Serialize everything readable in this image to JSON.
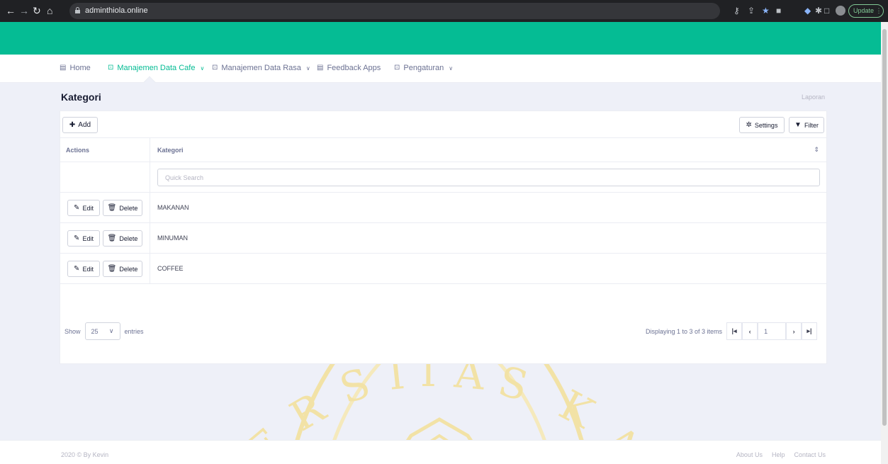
{
  "browser": {
    "url": "adminthiola.online",
    "update_label": "Update"
  },
  "menu": {
    "items": [
      {
        "label": "Home",
        "icon": "layout-icon"
      },
      {
        "label": "Manajemen Data Cafe",
        "icon": "box-icon",
        "active": true
      },
      {
        "label": "Manajemen Data Rasa",
        "icon": "box-icon"
      },
      {
        "label": "Feedback Apps",
        "icon": "layout-icon"
      },
      {
        "label": "Pengaturan",
        "icon": "box-icon"
      }
    ]
  },
  "page": {
    "title": "Kategori",
    "breadcrumb": "Laporan"
  },
  "toolbar": {
    "add_label": "Add",
    "settings_label": "Settings",
    "filter_label": "Filter"
  },
  "table": {
    "columns": [
      "Actions",
      "Kategori"
    ],
    "search_placeholder": "Quick Search",
    "edit_label": "Edit",
    "delete_label": "Delete",
    "rows": [
      {
        "kategori": "MAKANAN"
      },
      {
        "kategori": "MINUMAN"
      },
      {
        "kategori": "COFFEE"
      }
    ]
  },
  "pagination": {
    "show_label": "Show",
    "entries_value": "25",
    "entries_label": "entries",
    "info": "Displaying 1 to 3 of 3 items",
    "current_page": "1"
  },
  "footer": {
    "copyright": "2020 © By Kevin",
    "links": [
      "About Us",
      "Help",
      "Contact Us"
    ]
  },
  "watermark": {
    "text": "ERSITAS KA"
  },
  "colors": {
    "brand": "#05bc94",
    "watermark": "#f2e2a6"
  }
}
